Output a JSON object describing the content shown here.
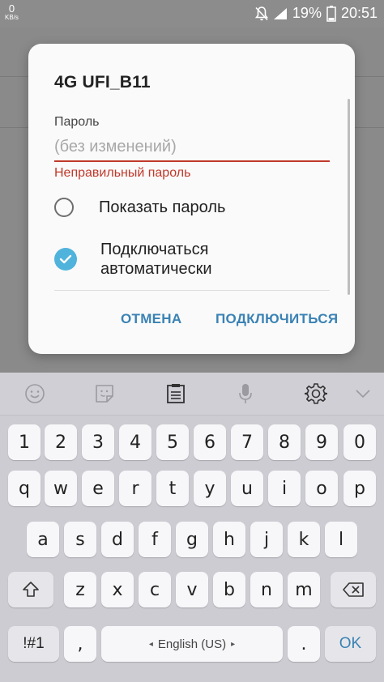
{
  "status_bar": {
    "data_rate": "0",
    "data_rate_unit": "KB/s",
    "battery": "19%",
    "time": "20:51"
  },
  "dialog": {
    "title": "4G UFI_B11",
    "password_label": "Пароль",
    "password_placeholder": "(без изменений)",
    "password_value": "",
    "error": "Неправильный пароль",
    "show_password": {
      "label": "Показать пароль",
      "checked": false
    },
    "auto_connect": {
      "label": "Подключаться автоматически",
      "checked": true
    },
    "cancel_label": "ОТМЕНА",
    "connect_label": "ПОДКЛЮЧИТЬСЯ"
  },
  "keyboard": {
    "toolbar": [
      "emoji-icon",
      "sticker-icon",
      "clipboard-icon",
      "microphone-icon",
      "settings-icon",
      "chevron-down-icon"
    ],
    "number_row": [
      "1",
      "2",
      "3",
      "4",
      "5",
      "6",
      "7",
      "8",
      "9",
      "0"
    ],
    "row1": [
      "q",
      "w",
      "e",
      "r",
      "t",
      "y",
      "u",
      "i",
      "o",
      "p"
    ],
    "row2": [
      "a",
      "s",
      "d",
      "f",
      "g",
      "h",
      "j",
      "k",
      "l"
    ],
    "row3": [
      "z",
      "x",
      "c",
      "v",
      "b",
      "n",
      "m"
    ],
    "symbols_label": "!#1",
    "comma": ",",
    "space_label": "English (US)",
    "space_left_arrow": "◂",
    "space_right_arrow": "▸",
    "period": ".",
    "ok_label": "OK"
  },
  "colors": {
    "accent": "#3a82b4",
    "error": "#c0392b",
    "checked": "#4fb3dc"
  }
}
